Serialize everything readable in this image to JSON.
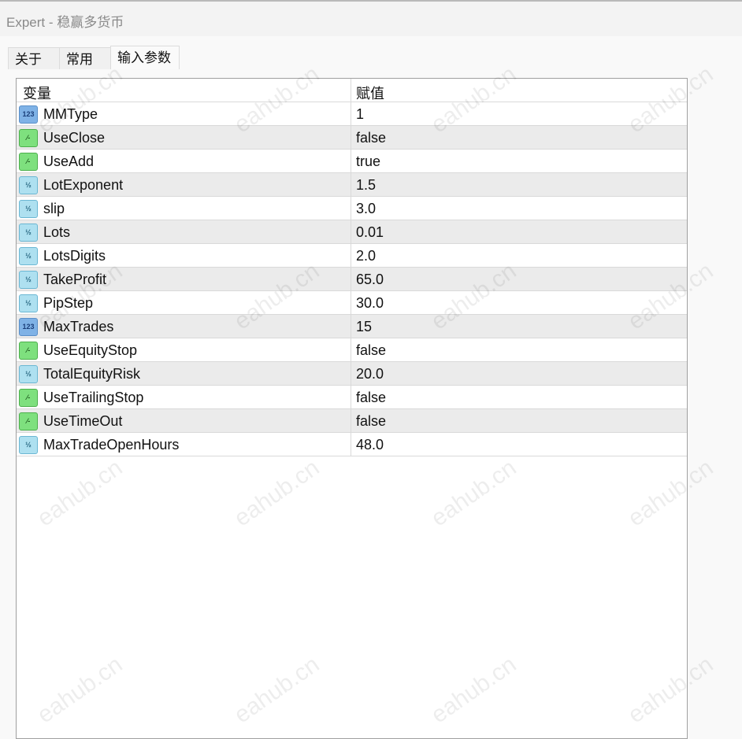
{
  "window": {
    "title": "Expert - 稳赢多货币"
  },
  "tabs": [
    {
      "label": "关于"
    },
    {
      "label": "常用"
    },
    {
      "label": "输入参数",
      "active": true
    }
  ],
  "table": {
    "headers": [
      "变量",
      "赋值"
    ],
    "rows": [
      {
        "name": "MMType",
        "value": "1",
        "type": "int"
      },
      {
        "name": "UseClose",
        "value": "false",
        "type": "bool"
      },
      {
        "name": "UseAdd",
        "value": "true",
        "type": "bool"
      },
      {
        "name": "LotExponent",
        "value": "1.5",
        "type": "double"
      },
      {
        "name": "slip",
        "value": "3.0",
        "type": "double"
      },
      {
        "name": "Lots",
        "value": "0.01",
        "type": "double"
      },
      {
        "name": "LotsDigits",
        "value": "2.0",
        "type": "double"
      },
      {
        "name": "TakeProfit",
        "value": "65.0",
        "type": "double"
      },
      {
        "name": "PipStep",
        "value": "30.0",
        "type": "double"
      },
      {
        "name": "MaxTrades",
        "value": "15",
        "type": "int"
      },
      {
        "name": "UseEquityStop",
        "value": "false",
        "type": "bool"
      },
      {
        "name": "TotalEquityRisk",
        "value": "20.0",
        "type": "double"
      },
      {
        "name": "UseTrailingStop",
        "value": "false",
        "type": "bool"
      },
      {
        "name": "UseTimeOut",
        "value": "false",
        "type": "bool"
      },
      {
        "name": "MaxTradeOpenHours",
        "value": "48.0",
        "type": "double"
      }
    ]
  },
  "icons": {
    "int": "123",
    "bool": "⁄-",
    "double": "½"
  },
  "watermark": "eahub.cn"
}
